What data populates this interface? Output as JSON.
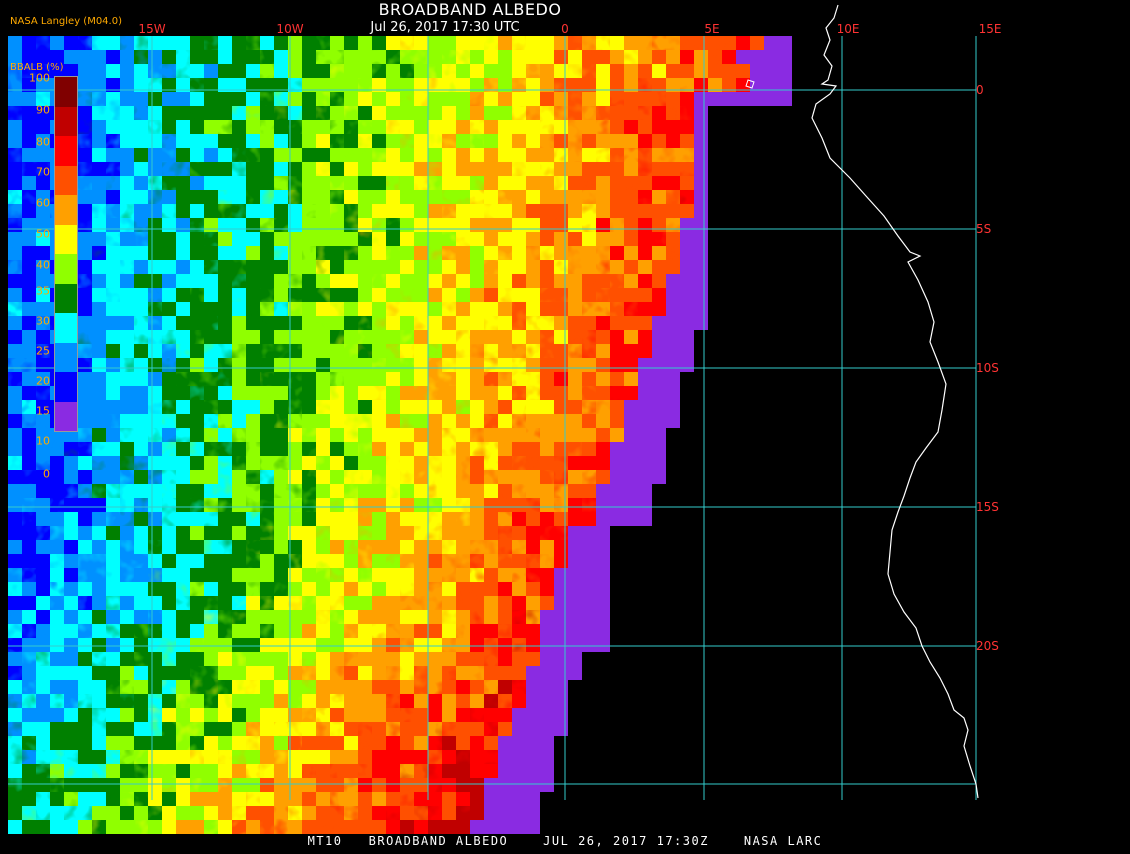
{
  "header": {
    "title": "BROADBAND ALBEDO",
    "datetime": "Jul 26, 2017 17:30 UTC",
    "credit": "NASA Langley (M04.0)"
  },
  "footer": {
    "text": "MT10   BROADBAND ALBEDO    JUL 26, 2017 17:30Z    NASA LARC"
  },
  "legend": {
    "title": "BBALB (%)",
    "ticks": [
      "100",
      "90",
      "80",
      "70",
      "60",
      "50",
      "40",
      "35",
      "30",
      "25",
      "20",
      "15",
      "10",
      "0"
    ],
    "colors": [
      "#800000",
      "#c00000",
      "#ff0000",
      "#ff5000",
      "#ffa000",
      "#ffff00",
      "#90ff00",
      "#008000",
      "#00ffff",
      "#0090ff",
      "#0000ff",
      "#8a2be2"
    ]
  },
  "map": {
    "lon_labels": [
      "15W",
      "10W",
      "0",
      "5E",
      "10E",
      "15E"
    ],
    "lat_labels": [
      "0",
      "5S",
      "10S",
      "15S",
      "20S"
    ],
    "grid_color": "#33cccc",
    "coast_color": "#ffffff",
    "background_color": "#000000",
    "label_color": "#ff3333"
  }
}
